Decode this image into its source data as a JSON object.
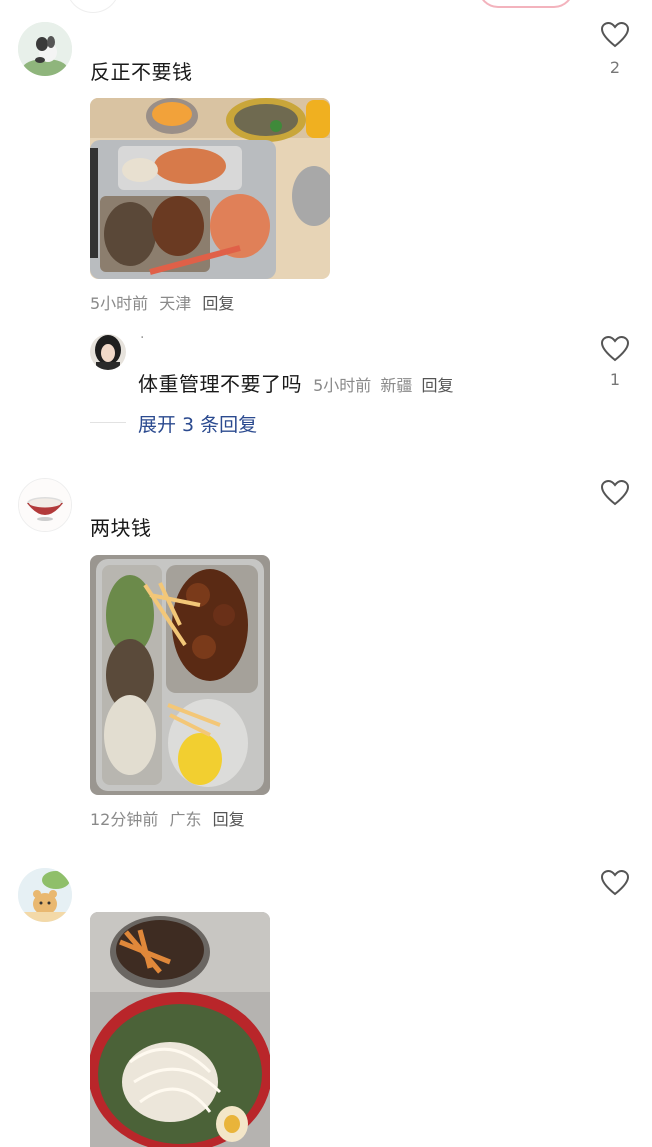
{
  "comments": [
    {
      "text": "反正不要钱",
      "time": "5小时前",
      "location": "天津",
      "reply_label": "回复",
      "likes": "2",
      "photo": "tray-with-crabs",
      "avatar": "dog-avatar"
    },
    {
      "text": "两块钱",
      "time": "12分钟前",
      "location": "广东",
      "reply_label": "回复",
      "likes": "",
      "photo": "tray-braised-pork-corn",
      "avatar": "bowl-avatar"
    },
    {
      "text": "",
      "time": "",
      "location": "",
      "reply_label": "",
      "likes": "",
      "photo": "noodle-bowl",
      "avatar": "bear-avatar"
    }
  ],
  "reply": {
    "username": "·",
    "text": "体重管理不要了吗",
    "time": "5小时前",
    "location": "新疆",
    "reply_label": "回复",
    "likes": "1"
  },
  "expand": {
    "label": "展开 3 条回复"
  },
  "colors": {
    "link_blue": "#2b4a8f",
    "meta_gray": "#8a8a8a",
    "follow_pink": "#f3b3bd"
  }
}
